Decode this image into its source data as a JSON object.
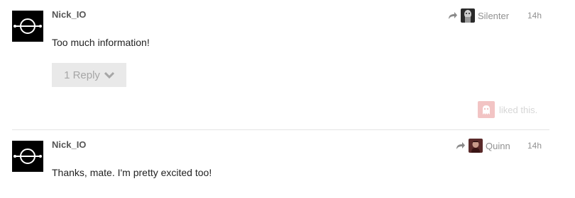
{
  "posts": [
    {
      "username": "Nick_IO",
      "reply_to": {
        "name": "Silenter",
        "icon": "reply-arrow-icon"
      },
      "timestamp": "14h",
      "body": "Too much information!",
      "replies_label": "1 Reply",
      "likes_text": "liked this."
    },
    {
      "username": "Nick_IO",
      "reply_to": {
        "name": "Quinn",
        "icon": "reply-arrow-icon"
      },
      "timestamp": "14h",
      "body": "Thanks, mate. I'm pretty excited too!"
    }
  ],
  "colors": {
    "avatar_bg": "#000000",
    "username": "#555555",
    "meta_text": "#919191",
    "button_bg": "#e9e9e9",
    "button_text": "#a6a6a6",
    "divider": "#e4e4e4",
    "like_avatar": "#f2c4c4"
  }
}
